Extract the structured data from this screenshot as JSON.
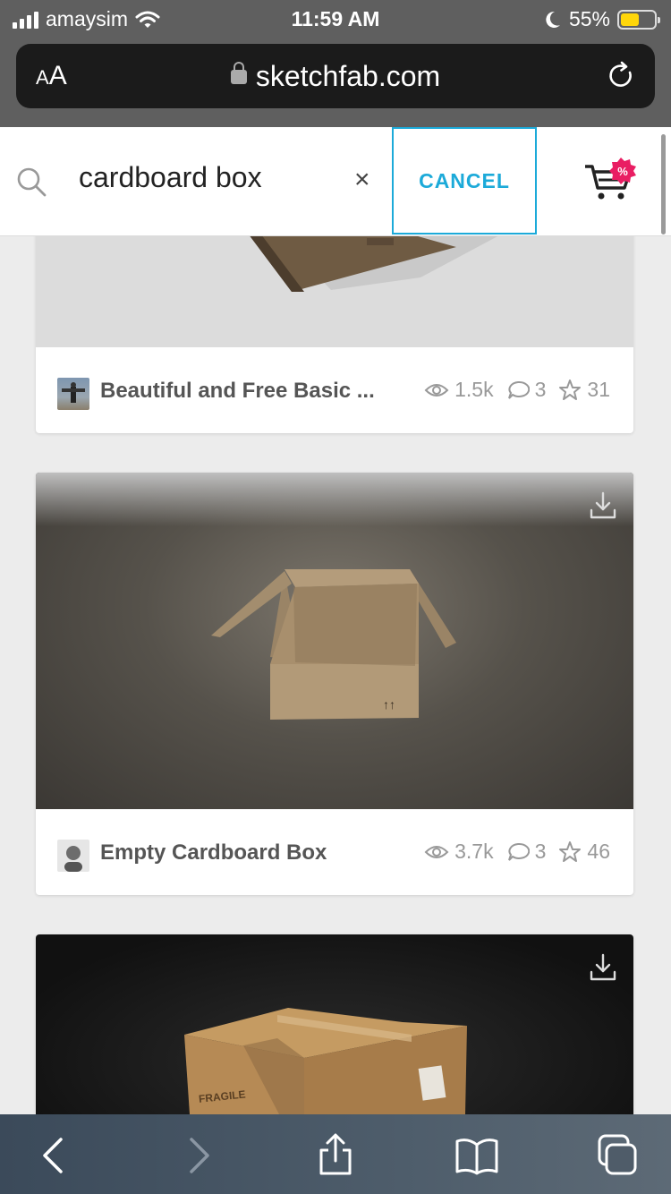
{
  "status_bar": {
    "carrier": "amaysim",
    "time": "11:59 AM",
    "battery_percent": "55%",
    "battery_level": 0.55,
    "icons": [
      "signal-icon",
      "wifi-icon",
      "moon-icon",
      "battery-icon"
    ]
  },
  "browser": {
    "text_size_label": "AA",
    "url": "sketchfab.com",
    "icons": [
      "lock-icon",
      "reload-icon"
    ]
  },
  "search": {
    "query": "cardboard box",
    "clear_label": "×",
    "cancel_label": "CANCEL",
    "cart_badge": "%"
  },
  "models": [
    {
      "title": "Beautiful and Free Basic ...",
      "views": "1.5k",
      "comments": "3",
      "likes": "31"
    },
    {
      "title": "Empty Cardboard Box",
      "views": "3.7k",
      "comments": "3",
      "likes": "46"
    }
  ],
  "third_model": {
    "box_label": "FRAGILE"
  },
  "toolbar": {
    "icons": [
      "back-icon",
      "forward-icon",
      "share-icon",
      "bookmarks-icon",
      "tabs-icon"
    ]
  },
  "colors": {
    "accent": "#1caad9",
    "badge": "#e91e63",
    "chrome": "#5f5f5f"
  }
}
